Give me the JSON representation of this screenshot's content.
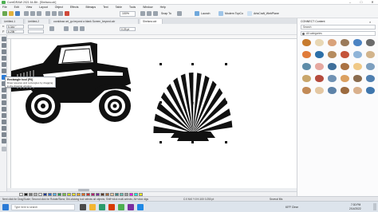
{
  "window": {
    "title": "CorelDRAW 2021 64-Bit - [Shelsea.cdr]"
  },
  "menu": [
    "File",
    "Edit",
    "View",
    "Layout",
    "Object",
    "Effects",
    "Bitmaps",
    "Text",
    "Table",
    "Tools",
    "Window",
    "Help"
  ],
  "toolbar": {
    "zoom_value": "100%",
    "snap_label": "Snap To",
    "launch_label": "Launch",
    "welcome_label": "Modern TopCo",
    "account_label": "ArtsCraft_WebPlane"
  },
  "tabs": [
    {
      "label": "Untitled-1",
      "active": false
    },
    {
      "label": "Untitled-2",
      "active": false
    },
    {
      "label": "coraldraw art_go beyond a blank Screen_beyond.cdr",
      "active": false
    },
    {
      "label": "Shelsea.cdr",
      "active": true
    }
  ],
  "propbar": {
    "x_value": "5.344 \"",
    "y_value": "6.298 \"",
    "w_value": "",
    "h_value": "",
    "stroke_value": "0.25 pt"
  },
  "tooltip": {
    "title": "Rectangle tool (F6)",
    "body": "Draw squares and rectangles by dragging in the drawing window."
  },
  "docker": {
    "title": "CONNECT Content",
    "search_placeholder": "Search",
    "category": "All categories"
  },
  "status": {
    "left": "Next click for Drag/Scale; Second click for Rotate/Skew; Dbl-clicking tool selects all objects; Shift+click multi-selects; Alt+click digs",
    "mid": "C:0 M:0 Y:0 K:100  0.250 pt",
    "right": "Several fills"
  },
  "taskbar": {
    "weather": "60°F Clear",
    "time": "7:30 PM",
    "date": "2/14/2022",
    "search_placeholder": "Type here to search"
  },
  "colors": {
    "accent": "#2b7bd6",
    "palette": [
      "#ffffff",
      "#000000",
      "#7a7a7a",
      "#b0b0b0",
      "#e6e6e6",
      "#1f3a93",
      "#2f6fd0",
      "#5ab0e6",
      "#2a9d55",
      "#7cc24b",
      "#c9d92b",
      "#f4e12a",
      "#f5a623",
      "#ea6b1f",
      "#d32f2f",
      "#b71c72",
      "#7b2da0",
      "#5b3a29",
      "#a86a3c",
      "#e8c9a0",
      "#3f8a8a",
      "#66c0b5",
      "#9b9b9b",
      "#ff00ff",
      "#00ffff",
      "#ffff00"
    ],
    "asset_colors": [
      "#c77b2e",
      "#e8d7b4",
      "#d9a27a",
      "#9a7a5a",
      "#4b83c3",
      "#6b6b6b",
      "#e07b39",
      "#2c6fa8",
      "#b58b5e",
      "#c4543a",
      "#8fb4d8",
      "#d2b48c",
      "#5e8ca8",
      "#e6a8a0",
      "#3e6e9a",
      "#a97142",
      "#f0c987",
      "#7d9fbf",
      "#c9a66b",
      "#b54a3c",
      "#6f91b3",
      "#dba060",
      "#8a6b4e",
      "#4f7fb0",
      "#c28a56",
      "#e4c7a2",
      "#5d82a8",
      "#9c6b3f",
      "#d9b08c",
      "#3f76ad"
    ]
  }
}
